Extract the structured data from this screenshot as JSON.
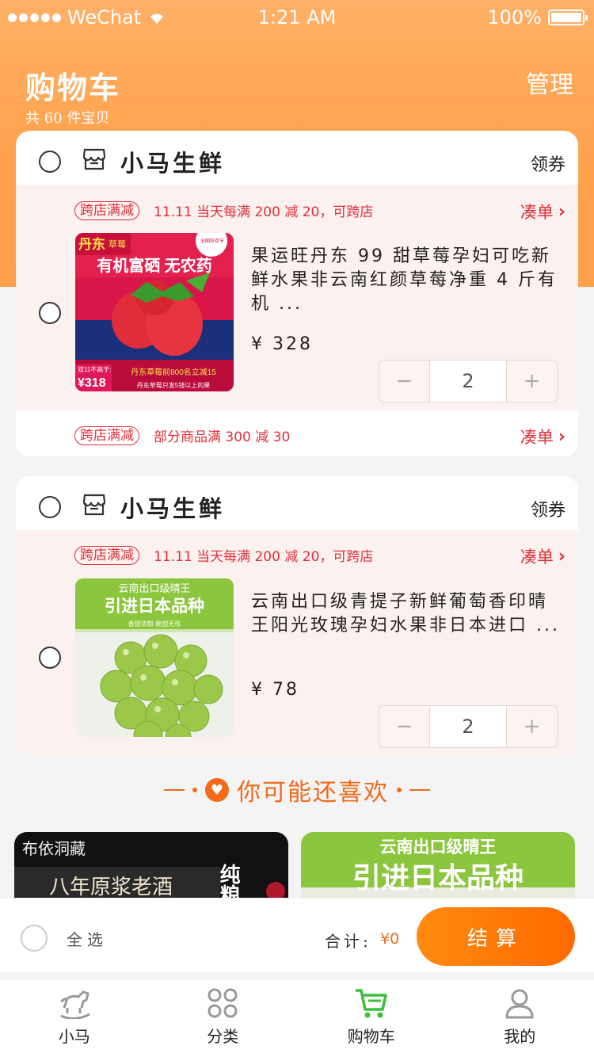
{
  "status_bar": {
    "carrier": "WeChat",
    "time": "1:21 AM",
    "battery": "100%"
  },
  "header": {
    "title": "购物车",
    "manage": "管理",
    "count_text": "共 60 件宝贝"
  },
  "stores": [
    {
      "name": "小马生鲜",
      "coupon": "领券",
      "promo_tag": "跨店满减",
      "promo_text": "11.11 当天每满 200 减 20，可跨店",
      "add_on": "凑单",
      "product": {
        "title": "果运旺丹东 99 甜草莓孕妇可吃新鲜水果非云南红颜草莓净重 4 斤有机 ...",
        "price": "¥ 328",
        "quantity": "2",
        "image": {
          "banner_left": "丹东",
          "banner_small": "草莓",
          "badge": "全国狂欢节",
          "headline": "有机富硒 无农药",
          "corner_small": "双11不高于:",
          "corner_price": "¥318",
          "footer1": "丹东草莓前800名立减15",
          "footer2": "丹东草莓只发5钱以上的果"
        }
      },
      "bottom_promo": {
        "tag": "跨店满减",
        "text": "部分商品满 300 减 30",
        "add_on": "凑单"
      }
    },
    {
      "name": "小马生鲜",
      "coupon": "领券",
      "promo_tag": "跨店满减",
      "promo_text": "11.11 当天每满 200 减 20，可跨店",
      "add_on": "凑单",
      "product": {
        "title": "云南出口级青提子新鲜葡萄香印晴王阳光玫瑰孕妇水果非日本进口 ...",
        "price": "¥ 78",
        "quantity": "2",
        "image": {
          "line1": "云南出口级晴王",
          "line2": "引进日本品种",
          "line3": "香甜浓郁·脆甜无核"
        }
      }
    }
  ],
  "recommend": {
    "title": "你可能还喜欢",
    "cards": [
      {
        "brand": "布依洞藏",
        "text": "八年原浆老酒",
        "side": "纯粮"
      },
      {
        "line1": "云南出口级晴王",
        "line2": "引进日本品种"
      }
    ]
  },
  "checkout": {
    "select_all": "全选",
    "total_label": "合计:",
    "total_value": "¥0",
    "button": "结算"
  },
  "tabs": [
    {
      "label": "小马",
      "icon": "rocking-horse-icon"
    },
    {
      "label": "分类",
      "icon": "grid-icon"
    },
    {
      "label": "购物车",
      "icon": "cart-icon",
      "active": true
    },
    {
      "label": "我的",
      "icon": "user-icon"
    }
  ],
  "colors": {
    "accent": "#ffa24d",
    "promo_red": "#e0303a",
    "orange": "#f26a1a",
    "cart_green": "#3dbf3a"
  }
}
